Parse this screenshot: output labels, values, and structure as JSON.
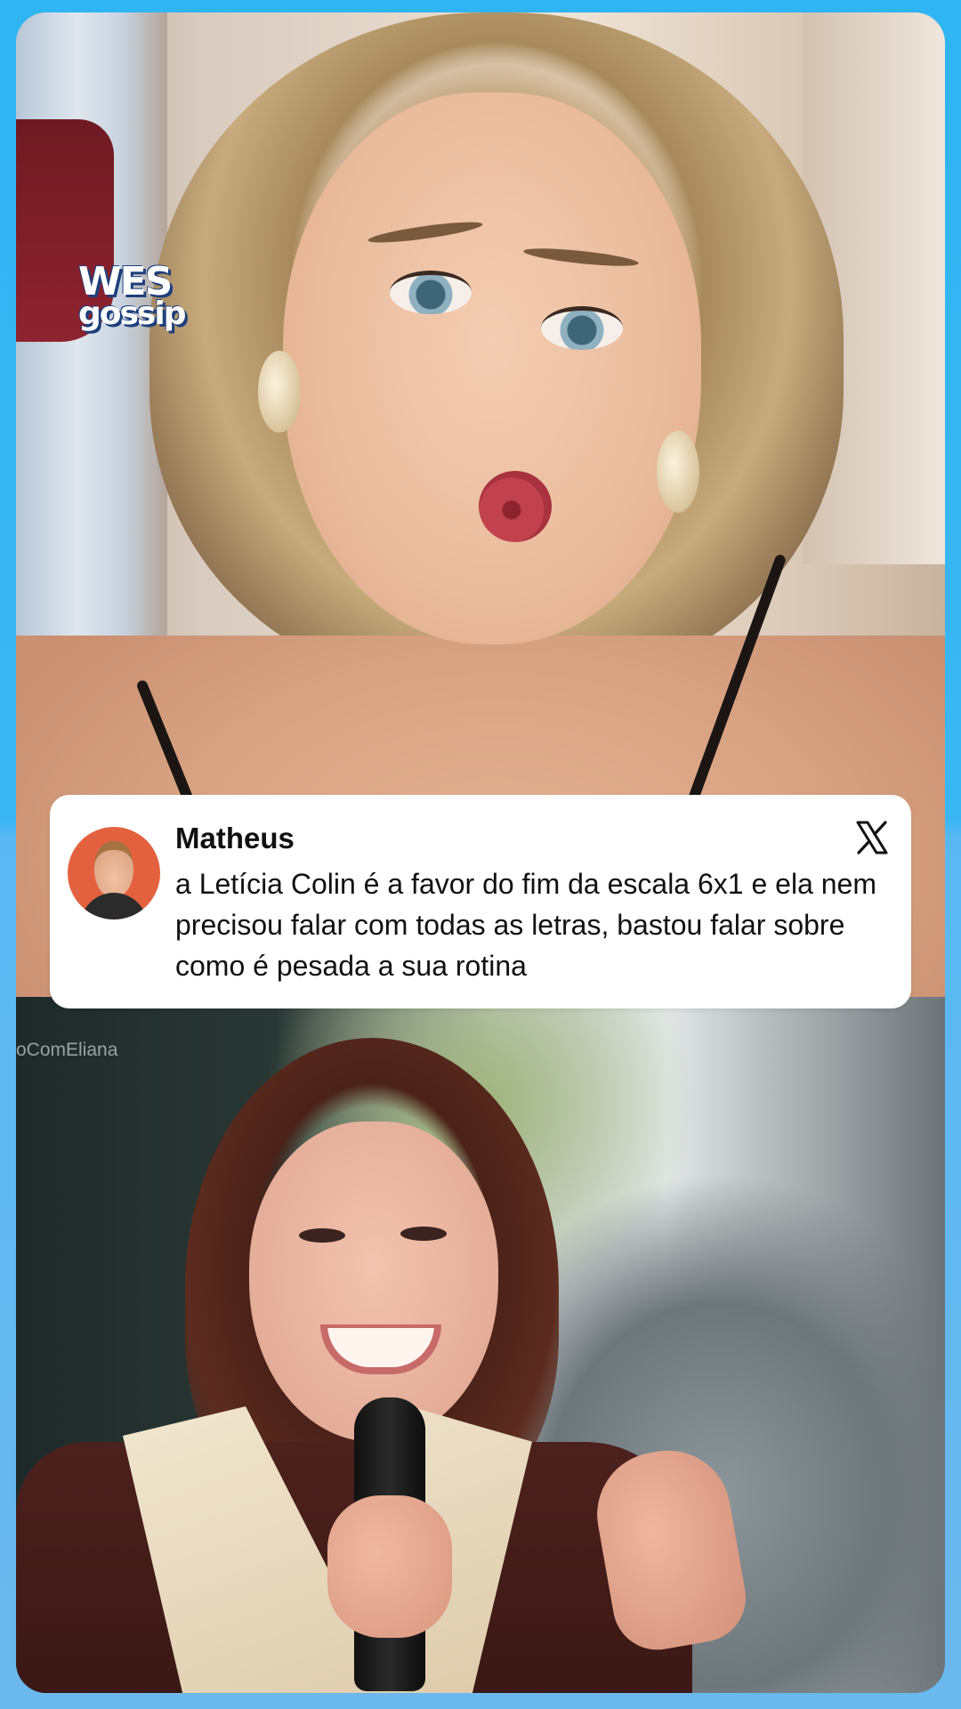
{
  "logo": {
    "line1": "WES",
    "line2": "gossip"
  },
  "tweet": {
    "author": "Matheus",
    "text": "a Letícia Colin é a favor do fim da escala 6x1 e ela nem precisou falar com todas as letras, bastou falar sobre como é pesada a sua rotina",
    "platform_icon": "x-logo-icon"
  },
  "video_watermark": "oComEliana",
  "colors": {
    "frame_blue": "#3bb6f4",
    "card_bg": "#ffffff",
    "avatar_bg": "#e4613f",
    "logo_outline": "#1d3f7c"
  }
}
